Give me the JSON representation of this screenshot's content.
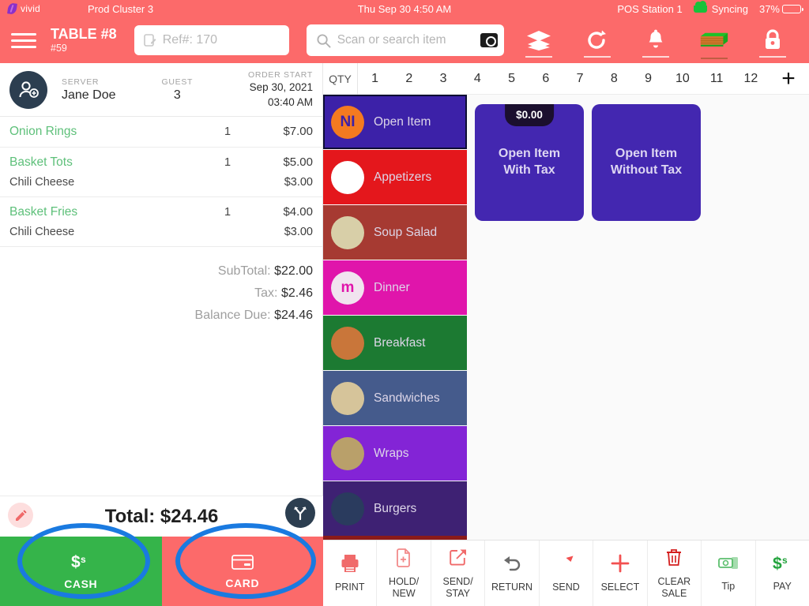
{
  "statusbar": {
    "logo_text": "vivid",
    "cluster": "Prod Cluster 3",
    "datetime": "Thu Sep 30 4:50 AM",
    "station": "POS Station 1",
    "sync_status": "Syncing",
    "battery": "37%"
  },
  "header": {
    "table_title": "TABLE #8",
    "table_sub": "#59",
    "ref_placeholder": "Ref#: 170",
    "search_placeholder": "Scan or search item",
    "icons": [
      "layers-icon",
      "refresh-icon",
      "bell-icon",
      "cash-book-icon",
      "lock-icon"
    ]
  },
  "order": {
    "server_label": "SERVER",
    "server_name": "Jane Doe",
    "guest_label": "GUEST",
    "guest_count": "3",
    "start_label": "ORDER START",
    "start_date": "Sep 30, 2021",
    "start_time": "03:40 AM",
    "items": [
      {
        "name": "Onion Rings",
        "qty": "1",
        "price": "$7.00",
        "modifier": "",
        "modifier_price": ""
      },
      {
        "name": "Basket Tots",
        "qty": "1",
        "price": "$5.00",
        "modifier": "Chili Cheese",
        "modifier_price": "$3.00"
      },
      {
        "name": "Basket Fries",
        "qty": "1",
        "price": "$4.00",
        "modifier": "Chili Cheese",
        "modifier_price": "$3.00"
      }
    ],
    "totals": [
      {
        "label": "SubTotal:",
        "value": "$22.00"
      },
      {
        "label": "Tax:",
        "value": "$2.46"
      },
      {
        "label": "Balance Due:",
        "value": "$24.46"
      }
    ],
    "grand_total": "Total: $24.46"
  },
  "payment": {
    "cash_label": "CASH",
    "card_label": "CARD"
  },
  "qty": {
    "label": "QTY",
    "values": [
      "1",
      "2",
      "3",
      "4",
      "5",
      "6",
      "7",
      "8",
      "9",
      "10",
      "11",
      "12"
    ],
    "add_label": "+"
  },
  "categories": [
    {
      "label": "Open Item",
      "color": "#3c21a8",
      "icon_bg": "#f47a20",
      "icon_text": "NI",
      "selected": true
    },
    {
      "label": "Appetizers",
      "color": "#e4171c",
      "icon_bg": "#ffffff",
      "icon_text": "",
      "selected": false
    },
    {
      "label": "Soup Salad",
      "color": "#a63a32",
      "icon_bg": "#d8cfa8",
      "icon_text": "",
      "selected": false
    },
    {
      "label": "Dinner",
      "color": "#e015ab",
      "icon_bg": "#f1e4ef",
      "icon_text": "m",
      "selected": false
    },
    {
      "label": "Breakfast",
      "color": "#1c7a32",
      "icon_bg": "#c9763a",
      "icon_text": "",
      "selected": false
    },
    {
      "label": "Sandwiches",
      "color": "#455b8c",
      "icon_bg": "#d6c49a",
      "icon_text": "",
      "selected": false
    },
    {
      "label": "Wraps",
      "color": "#8324d6",
      "icon_bg": "#b9a06a",
      "icon_text": "",
      "selected": false
    },
    {
      "label": "Burgers",
      "color": "#3e2173",
      "icon_bg": "#2a3b5e",
      "icon_text": "",
      "selected": false
    }
  ],
  "products": [
    {
      "label": "Open Item\nWith Tax",
      "badge": "$0.00"
    },
    {
      "label": "Open Item\nWithout Tax",
      "badge": ""
    }
  ],
  "bottom_toolbar": [
    {
      "label": "PRINT",
      "icon": "printer-icon",
      "color": "#f06a6a"
    },
    {
      "label": "HOLD/\nNEW",
      "icon": "hold-new-icon",
      "color": "#f28a8a"
    },
    {
      "label": "SEND/\nSTAY",
      "icon": "send-stay-icon",
      "color": "#f06a6a"
    },
    {
      "label": "RETURN",
      "icon": "return-icon",
      "color": "#6b6b6b"
    },
    {
      "label": "SEND",
      "icon": "send-icon",
      "color": "#f25050"
    },
    {
      "label": "SELECT",
      "icon": "plus-icon",
      "color": "#f25050"
    },
    {
      "label": "CLEAR\nSALE",
      "icon": "trash-icon",
      "color": "#d41e1e"
    },
    {
      "label": "Tip",
      "icon": "tip-money-icon",
      "color": "#5cbf6e"
    },
    {
      "label": "PAY",
      "icon": "pay-dollar-icon",
      "color": "#22a33c"
    }
  ]
}
